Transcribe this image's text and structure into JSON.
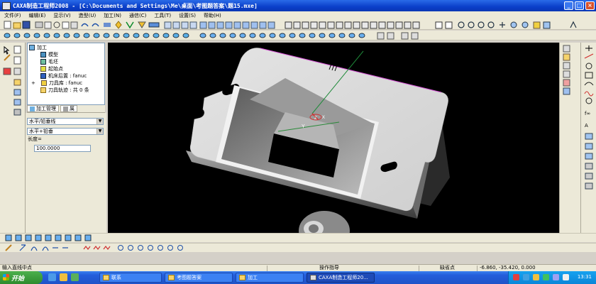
{
  "window": {
    "title": "CAXA制造工程师2008  - [C:\\Documents and Settings\\Me\\桌面\\考图题答案\\题15.mxe]",
    "buttons": [
      "_",
      "□",
      "×"
    ]
  },
  "menu": [
    "文件(F)",
    "编辑(E)",
    "显示(V)",
    "造型(U)",
    "加工(N)",
    "通信(C)",
    "工具(T)",
    "设置(S)",
    "帮助(H)"
  ],
  "tree": {
    "root": "加工",
    "items": [
      {
        "label": "模型"
      },
      {
        "label": "毛坯"
      },
      {
        "label": "起始点"
      },
      {
        "label": "机床后置 : fanuc"
      },
      {
        "label": "刀具库 : fanuc"
      },
      {
        "label": "刀具轨迹 : 共 0 条"
      }
    ]
  },
  "panel_tabs": [
    "加工管理",
    "属"
  ],
  "props": {
    "combo1": "水平/铅垂线",
    "combo2": "水平+铅垂",
    "length_label": "长度=",
    "length_value": "100.0000"
  },
  "viewport": {
    "axis_labels": [
      "Y",
      "Z",
      "X"
    ],
    "background": "#000000"
  },
  "status": {
    "prompt": "输入直线中点",
    "op_guide": "操作指导",
    "snap": "缺省点",
    "coords": "-6.860, -35.420, 0.000"
  },
  "taskbar": {
    "start": "开始",
    "tasks": [
      "联系",
      "考图题答案",
      "加工",
      "CAXA制造工程师20..."
    ],
    "clock": "13:31"
  },
  "colors": {
    "titlebar": "#0a3fc9",
    "viewport_bg": "#000000",
    "taskbar": "#245edb",
    "start_button": "#2e8b2e"
  }
}
